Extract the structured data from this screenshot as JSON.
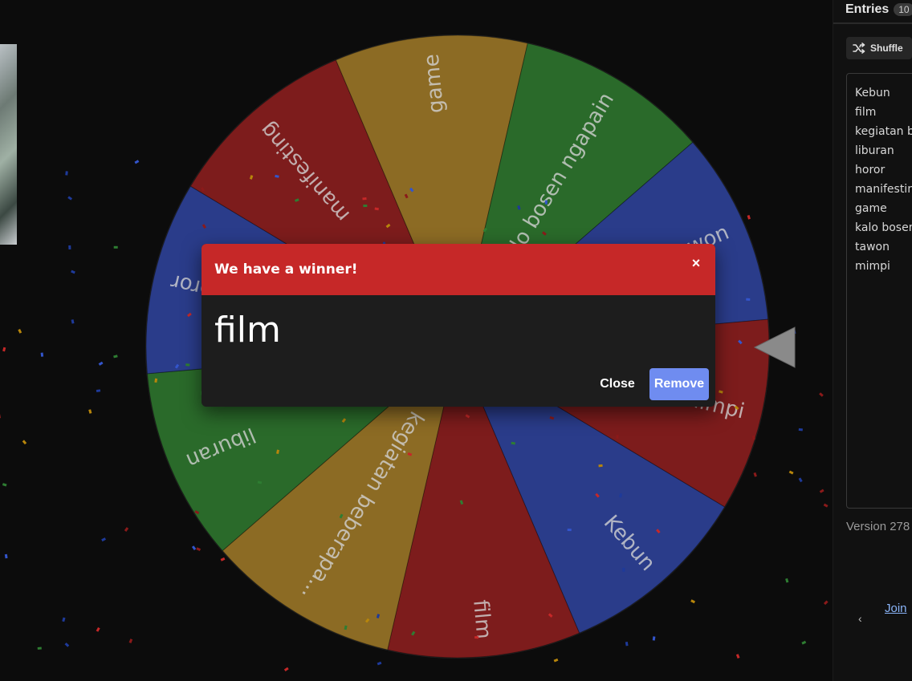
{
  "wheel": {
    "segments": [
      {
        "label": "Kebun",
        "color": "#2a3c8a"
      },
      {
        "label": "film",
        "color": "#7d1c1c"
      },
      {
        "label": "kegiatan beberapa...",
        "color": "#8c6b24"
      },
      {
        "label": "liburan",
        "color": "#2a6a2a"
      },
      {
        "label": "horor",
        "color": "#2a3c8a"
      },
      {
        "label": "manifesting",
        "color": "#7d1c1c"
      },
      {
        "label": "game",
        "color": "#8c6b24"
      },
      {
        "label": "kalo bosen ngapain",
        "color": "#2a6a2a"
      },
      {
        "label": "tawon",
        "color": "#2a3c8a"
      },
      {
        "label": "mimpi",
        "color": "#7d1c1c"
      }
    ]
  },
  "panel": {
    "tab_label": "Entries",
    "entries_count": "10",
    "shuffle_label": "Shuffle",
    "entries": [
      "Kebun",
      "film",
      "kegiatan b",
      "liburan",
      "horor",
      "manifestin",
      "game",
      "kalo bosen",
      "tawon",
      "mimpi"
    ],
    "version_text": "Version 278",
    "join_text": "Join",
    "collapse_glyph": "‹"
  },
  "dialog": {
    "title": "We have a winner!",
    "close_glyph": "×",
    "winner": "film",
    "close_label": "Close",
    "remove_label": "Remove"
  },
  "colors": {
    "accent_red": "#c62828",
    "remove_blue": "#6f8cf0",
    "background": "#0c0c0c"
  }
}
